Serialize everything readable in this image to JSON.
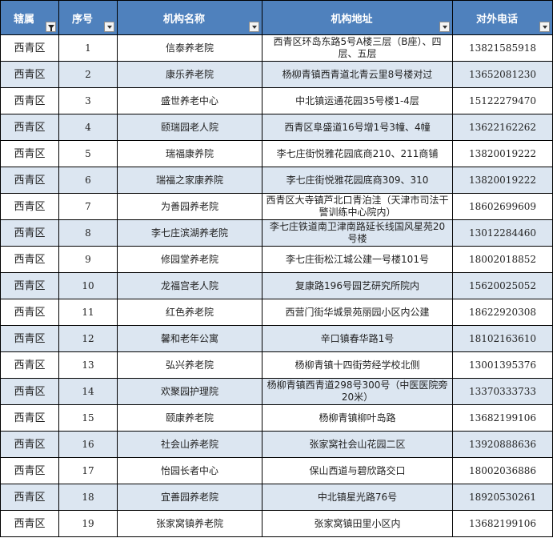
{
  "headers": [
    "辖属",
    "序号",
    "机构名称",
    "机构地址",
    "对外电话"
  ],
  "rows": [
    {
      "district": "西青区",
      "no": "1",
      "name": "信泰养老院",
      "address": "西青区环岛东路5号A楼三层（B座）、四层、五层",
      "phone": "13821585918"
    },
    {
      "district": "西青区",
      "no": "2",
      "name": "康乐养老院",
      "address": "杨柳青镇西青道北青云里8号楼对过",
      "phone": "13652081230"
    },
    {
      "district": "西青区",
      "no": "3",
      "name": "盛世养老中心",
      "address": "中北镇运通花园35号楼1-4层",
      "phone": "15122279470"
    },
    {
      "district": "西青区",
      "no": "4",
      "name": "颐瑞园老人院",
      "address": "西青区阜盛道16号增1号3幢、4幢",
      "phone": "13622162262"
    },
    {
      "district": "西青区",
      "no": "5",
      "name": "瑞福康养院",
      "address": "李七庄街悦雅花园底商210、211商铺",
      "phone": "13820019222"
    },
    {
      "district": "西青区",
      "no": "6",
      "name": "瑞福之家康养院",
      "address": "李七庄街悦雅花园底商309、310",
      "phone": "13820019222"
    },
    {
      "district": "西青区",
      "no": "7",
      "name": "为善园养老院",
      "address": "西青区大寺镇芦北口青泊洼（天津市司法干警训练中心院内）",
      "phone": "18602699609"
    },
    {
      "district": "西青区",
      "no": "8",
      "name": "李七庄滨湖养老院",
      "address": "李七庄铁道南卫津南路延长线国风星苑20号楼",
      "phone": "13012284460"
    },
    {
      "district": "西青区",
      "no": "9",
      "name": "修园堂养老院",
      "address": "李七庄街松江城公建一号楼101号",
      "phone": "18002018852"
    },
    {
      "district": "西青区",
      "no": "10",
      "name": "龙福宫老人院",
      "address": "复康路196号园艺研究所院内",
      "phone": "15620025052"
    },
    {
      "district": "西青区",
      "no": "11",
      "name": "红色养老院",
      "address": "西营门街华城景苑丽园小区内公建",
      "phone": "18622920308"
    },
    {
      "district": "西青区",
      "no": "12",
      "name": "馨和老年公寓",
      "address": "辛口镇春华路1号",
      "phone": "18102163610"
    },
    {
      "district": "西青区",
      "no": "13",
      "name": "弘兴养老院",
      "address": "杨柳青镇十四街劳经学校北侧",
      "phone": "13001395376"
    },
    {
      "district": "西青区",
      "no": "14",
      "name": "欢聚园护理院",
      "address": "杨柳青镇西青道298号300号（中医医院旁20米）",
      "phone": "13370333733"
    },
    {
      "district": "西青区",
      "no": "15",
      "name": "颐康养老院",
      "address": "杨柳青镇柳叶岛路",
      "phone": "13682199106"
    },
    {
      "district": "西青区",
      "no": "16",
      "name": "社会山养老院",
      "address": "张家窝社会山花园二区",
      "phone": "13920888636"
    },
    {
      "district": "西青区",
      "no": "17",
      "name": "怡园长者中心",
      "address": "保山西道与碧欣路交口",
      "phone": "18002036886"
    },
    {
      "district": "西青区",
      "no": "18",
      "name": "宜善园养老院",
      "address": "中北镇星光路76号",
      "phone": "18920530261"
    },
    {
      "district": "西青区",
      "no": "19",
      "name": "张家窝镇养老院",
      "address": "张家窝镇田里小区内",
      "phone": "13682199106"
    }
  ]
}
